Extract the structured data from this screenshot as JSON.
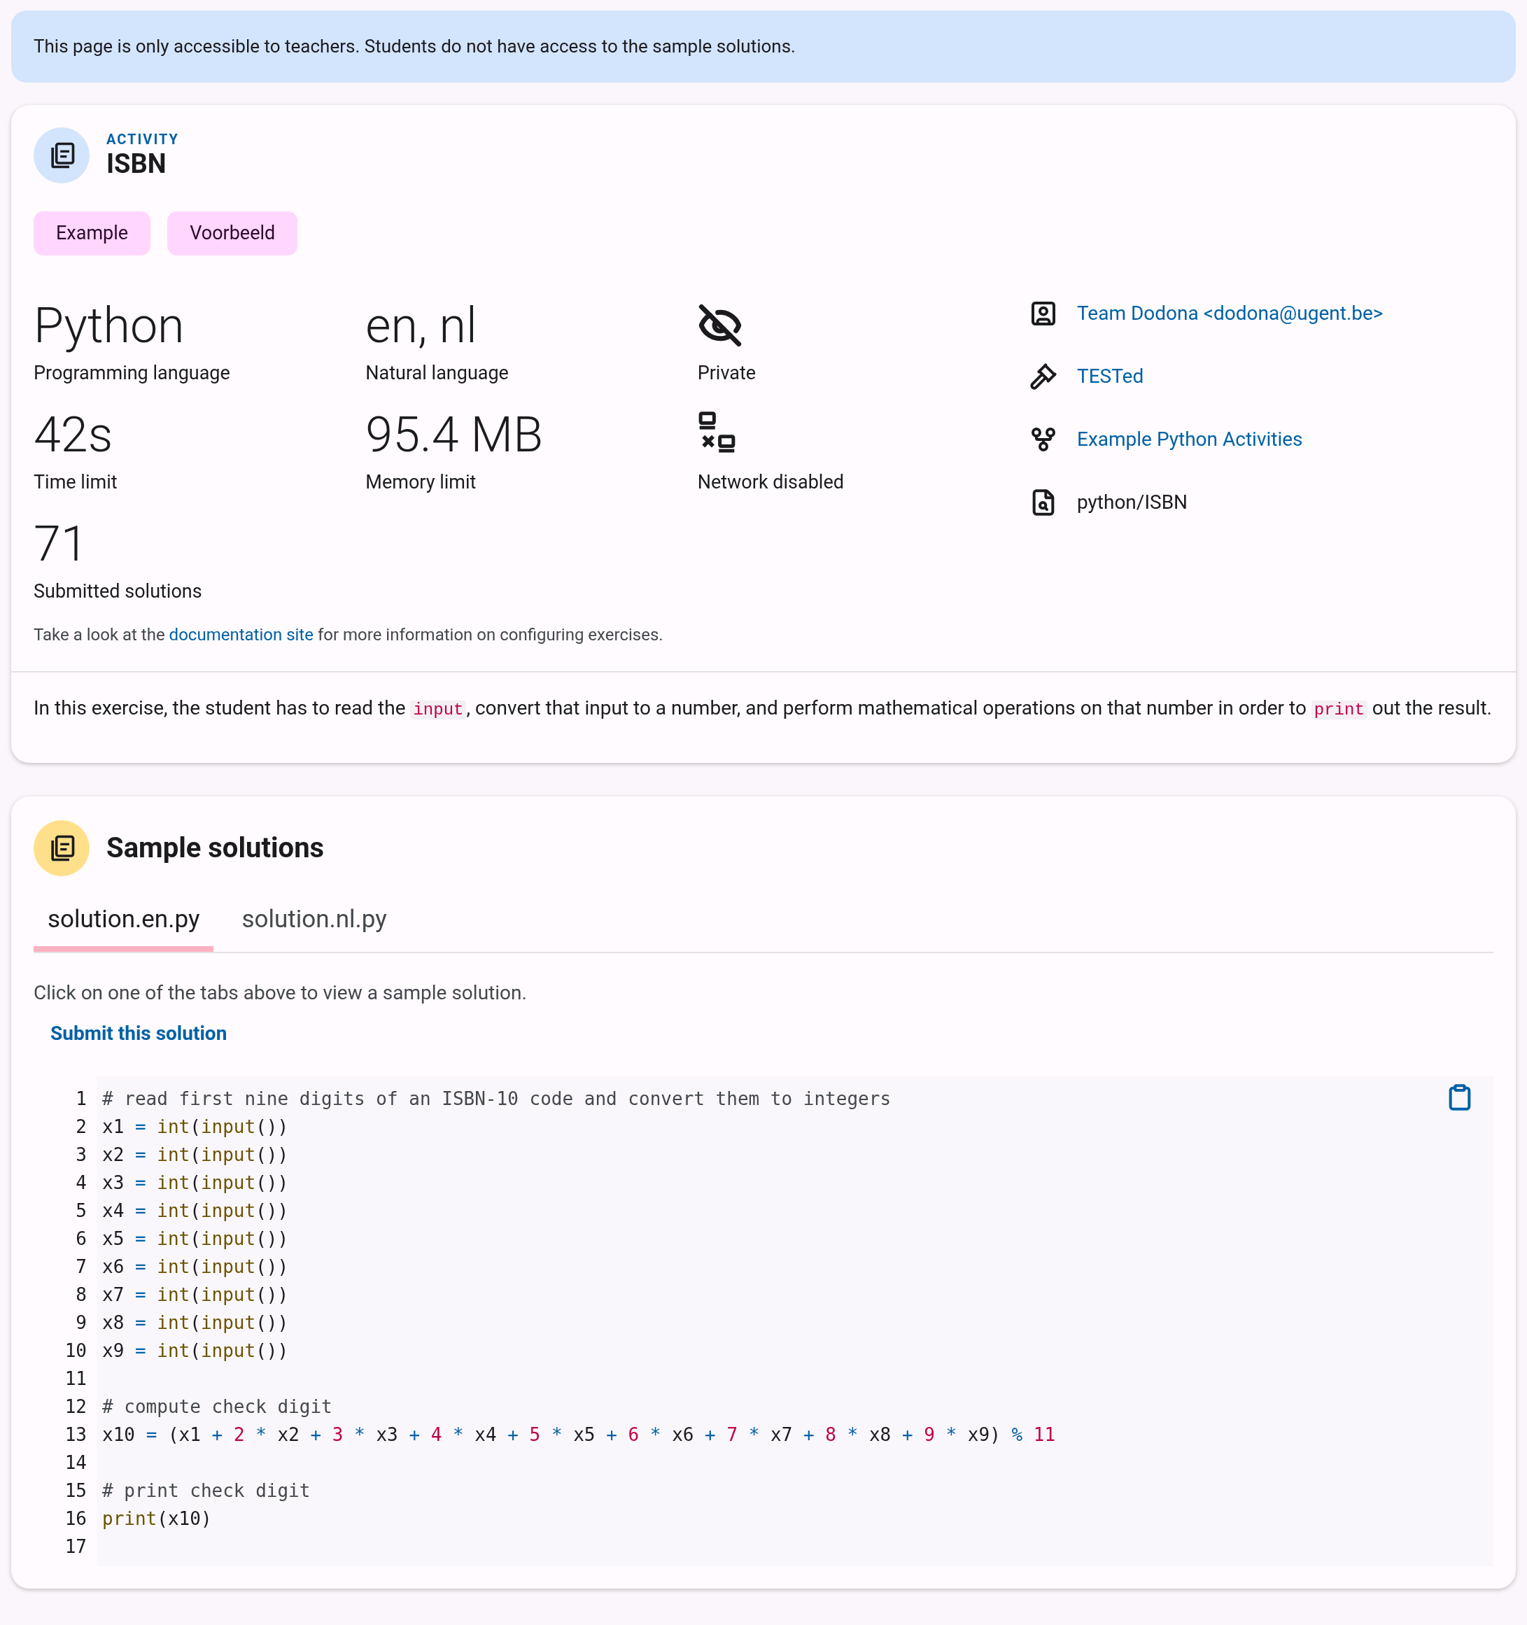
{
  "notice": "This page is only accessible to teachers. Students do not have access to the sample solutions.",
  "activity": {
    "kicker": "ACTIVITY",
    "title": "ISBN",
    "tags": [
      "Example",
      "Voorbeeld"
    ],
    "stats": [
      {
        "kind": "value",
        "value": "Python",
        "label": "Programming language"
      },
      {
        "kind": "value",
        "value": "en, nl",
        "label": "Natural language"
      },
      {
        "kind": "hidden",
        "label": "Private"
      },
      {
        "kind": "value",
        "value": "42s",
        "label": "Time limit"
      },
      {
        "kind": "value",
        "value": "95.4 MB",
        "label": "Memory limit"
      },
      {
        "kind": "offline",
        "label": "Network disabled"
      },
      {
        "kind": "value",
        "value": "71",
        "label": "Submitted solutions"
      }
    ],
    "details": [
      {
        "text": "Team Dodona <dodona@ugent.be>",
        "link": true
      },
      {
        "text": "TESTed",
        "link": true
      },
      {
        "text": "Example Python Activities",
        "link": true
      },
      {
        "text": "python/ISBN",
        "link": false
      }
    ],
    "help": {
      "before": "Take a look at the ",
      "link": "documentation site",
      "after": " for more information on configuring exercises."
    },
    "description": [
      {
        "kind": "text",
        "text": "In this exercise, the student has to read the "
      },
      {
        "kind": "code",
        "text": "input"
      },
      {
        "kind": "text",
        "text": ", convert that input to a number, and perform mathematical operations on that number in order to "
      },
      {
        "kind": "code",
        "text": "print"
      },
      {
        "kind": "text",
        "text": " out the result."
      }
    ]
  },
  "solutions": {
    "title": "Sample solutions",
    "tabs": [
      {
        "label": "solution.en.py",
        "selected": true
      },
      {
        "label": "solution.nl.py",
        "selected": false
      }
    ],
    "hint": "Click on one of the tabs above to view a sample solution.",
    "submit": "Submit this solution",
    "lines": [
      {
        "number": "1",
        "tokens": [
          {
            "kind": "comment",
            "text": "# read first nine digits of an ISBN-10 code and convert them to integers"
          }
        ]
      },
      {
        "number": "2",
        "tokens": [
          {
            "kind": "plain",
            "text": "x1 "
          },
          {
            "kind": "op",
            "text": "= "
          },
          {
            "kind": "builtin",
            "text": "int"
          },
          {
            "kind": "plain",
            "text": "("
          },
          {
            "kind": "builtin",
            "text": "input"
          },
          {
            "kind": "plain",
            "text": "())"
          }
        ]
      },
      {
        "number": "3",
        "tokens": [
          {
            "kind": "plain",
            "text": "x2 "
          },
          {
            "kind": "op",
            "text": "= "
          },
          {
            "kind": "builtin",
            "text": "int"
          },
          {
            "kind": "plain",
            "text": "("
          },
          {
            "kind": "builtin",
            "text": "input"
          },
          {
            "kind": "plain",
            "text": "())"
          }
        ]
      },
      {
        "number": "4",
        "tokens": [
          {
            "kind": "plain",
            "text": "x3 "
          },
          {
            "kind": "op",
            "text": "= "
          },
          {
            "kind": "builtin",
            "text": "int"
          },
          {
            "kind": "plain",
            "text": "("
          },
          {
            "kind": "builtin",
            "text": "input"
          },
          {
            "kind": "plain",
            "text": "())"
          }
        ]
      },
      {
        "number": "5",
        "tokens": [
          {
            "kind": "plain",
            "text": "x4 "
          },
          {
            "kind": "op",
            "text": "= "
          },
          {
            "kind": "builtin",
            "text": "int"
          },
          {
            "kind": "plain",
            "text": "("
          },
          {
            "kind": "builtin",
            "text": "input"
          },
          {
            "kind": "plain",
            "text": "())"
          }
        ]
      },
      {
        "number": "6",
        "tokens": [
          {
            "kind": "plain",
            "text": "x5 "
          },
          {
            "kind": "op",
            "text": "= "
          },
          {
            "kind": "builtin",
            "text": "int"
          },
          {
            "kind": "plain",
            "text": "("
          },
          {
            "kind": "builtin",
            "text": "input"
          },
          {
            "kind": "plain",
            "text": "())"
          }
        ]
      },
      {
        "number": "7",
        "tokens": [
          {
            "kind": "plain",
            "text": "x6 "
          },
          {
            "kind": "op",
            "text": "= "
          },
          {
            "kind": "builtin",
            "text": "int"
          },
          {
            "kind": "plain",
            "text": "("
          },
          {
            "kind": "builtin",
            "text": "input"
          },
          {
            "kind": "plain",
            "text": "())"
          }
        ]
      },
      {
        "number": "8",
        "tokens": [
          {
            "kind": "plain",
            "text": "x7 "
          },
          {
            "kind": "op",
            "text": "= "
          },
          {
            "kind": "builtin",
            "text": "int"
          },
          {
            "kind": "plain",
            "text": "("
          },
          {
            "kind": "builtin",
            "text": "input"
          },
          {
            "kind": "plain",
            "text": "())"
          }
        ]
      },
      {
        "number": "9",
        "tokens": [
          {
            "kind": "plain",
            "text": "x8 "
          },
          {
            "kind": "op",
            "text": "= "
          },
          {
            "kind": "builtin",
            "text": "int"
          },
          {
            "kind": "plain",
            "text": "("
          },
          {
            "kind": "builtin",
            "text": "input"
          },
          {
            "kind": "plain",
            "text": "())"
          }
        ]
      },
      {
        "number": "10",
        "tokens": [
          {
            "kind": "plain",
            "text": "x9 "
          },
          {
            "kind": "op",
            "text": "= "
          },
          {
            "kind": "builtin",
            "text": "int"
          },
          {
            "kind": "plain",
            "text": "("
          },
          {
            "kind": "builtin",
            "text": "input"
          },
          {
            "kind": "plain",
            "text": "())"
          }
        ]
      },
      {
        "number": "11"
      },
      {
        "number": "12",
        "tokens": [
          {
            "kind": "comment",
            "text": "# compute check digit"
          }
        ]
      },
      {
        "number": "13",
        "tokens": [
          {
            "kind": "plain",
            "text": "x10 "
          },
          {
            "kind": "op",
            "text": "= "
          },
          {
            "kind": "plain",
            "text": "(x1 "
          },
          {
            "kind": "op",
            "text": "+ "
          },
          {
            "kind": "number",
            "text": "2"
          },
          {
            "kind": "op",
            "text": " * "
          },
          {
            "kind": "plain",
            "text": "x2 "
          },
          {
            "kind": "op",
            "text": "+ "
          },
          {
            "kind": "number",
            "text": "3"
          },
          {
            "kind": "op",
            "text": " * "
          },
          {
            "kind": "plain",
            "text": "x3 "
          },
          {
            "kind": "op",
            "text": "+ "
          },
          {
            "kind": "number",
            "text": "4"
          },
          {
            "kind": "op",
            "text": " * "
          },
          {
            "kind": "plain",
            "text": "x4 "
          },
          {
            "kind": "op",
            "text": "+ "
          },
          {
            "kind": "number",
            "text": "5"
          },
          {
            "kind": "op",
            "text": " * "
          },
          {
            "kind": "plain",
            "text": "x5 "
          },
          {
            "kind": "op",
            "text": "+ "
          },
          {
            "kind": "number",
            "text": "6"
          },
          {
            "kind": "op",
            "text": " * "
          },
          {
            "kind": "plain",
            "text": "x6 "
          },
          {
            "kind": "op",
            "text": "+ "
          },
          {
            "kind": "number",
            "text": "7"
          },
          {
            "kind": "op",
            "text": " * "
          },
          {
            "kind": "plain",
            "text": "x7 "
          },
          {
            "kind": "op",
            "text": "+ "
          },
          {
            "kind": "number",
            "text": "8"
          },
          {
            "kind": "op",
            "text": " * "
          },
          {
            "kind": "plain",
            "text": "x8 "
          },
          {
            "kind": "op",
            "text": "+ "
          },
          {
            "kind": "number",
            "text": "9"
          },
          {
            "kind": "op",
            "text": " * "
          },
          {
            "kind": "plain",
            "text": "x9) "
          },
          {
            "kind": "op",
            "text": "% "
          },
          {
            "kind": "number",
            "text": "11"
          }
        ]
      },
      {
        "number": "14"
      },
      {
        "number": "15",
        "tokens": [
          {
            "kind": "comment",
            "text": "# print check digit"
          }
        ]
      },
      {
        "number": "16",
        "tokens": [
          {
            "kind": "builtin",
            "text": "print"
          },
          {
            "kind": "plain",
            "text": "(x10)"
          }
        ]
      },
      {
        "number": "17"
      }
    ]
  }
}
